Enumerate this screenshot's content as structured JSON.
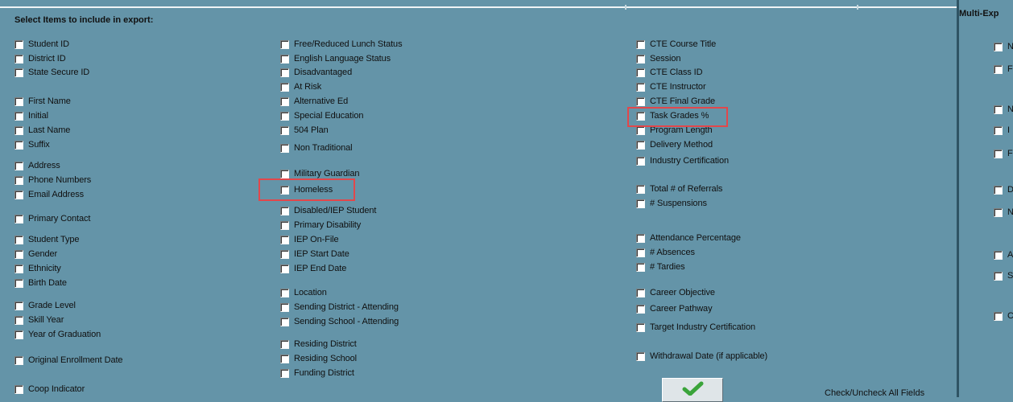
{
  "header": {
    "title": "Select Items to include in export:",
    "right_title": "Multi-Exp"
  },
  "columns": [
    {
      "items": [
        {
          "label": "Student ID",
          "checked": false
        },
        {
          "label": "District ID",
          "checked": false
        },
        {
          "label": "State Secure ID",
          "checked": false
        },
        {
          "label": "First Name",
          "checked": false
        },
        {
          "label": "Initial",
          "checked": false
        },
        {
          "label": "Last Name",
          "checked": false
        },
        {
          "label": "Suffix",
          "checked": false
        },
        {
          "label": "Address",
          "checked": false
        },
        {
          "label": "Phone Numbers",
          "checked": false
        },
        {
          "label": "Email Address",
          "checked": false
        },
        {
          "label": "Primary Contact",
          "checked": false
        },
        {
          "label": "Student Type",
          "checked": false
        },
        {
          "label": "Gender",
          "checked": false
        },
        {
          "label": "Ethnicity",
          "checked": false
        },
        {
          "label": "Birth Date",
          "checked": false
        },
        {
          "label": "Grade Level",
          "checked": false
        },
        {
          "label": "Skill Year",
          "checked": false
        },
        {
          "label": "Year of Graduation",
          "checked": false
        },
        {
          "label": "Original Enrollment Date",
          "checked": false
        },
        {
          "label": "Coop Indicator",
          "checked": false
        }
      ]
    },
    {
      "items": [
        {
          "label": "Free/Reduced Lunch Status",
          "checked": false
        },
        {
          "label": "English Language Status",
          "checked": false
        },
        {
          "label": "Disadvantaged",
          "checked": false
        },
        {
          "label": "At Risk",
          "checked": false
        },
        {
          "label": "Alternative Ed",
          "checked": false
        },
        {
          "label": "Special Education",
          "checked": false
        },
        {
          "label": "504 Plan",
          "checked": false
        },
        {
          "label": "Non Traditional",
          "checked": false
        },
        {
          "label": "Military Guardian",
          "checked": false
        },
        {
          "label": "Homeless",
          "checked": false,
          "highlighted": true
        },
        {
          "label": "Disabled/IEP Student",
          "checked": false
        },
        {
          "label": "Primary Disability",
          "checked": false
        },
        {
          "label": "IEP On-File",
          "checked": false
        },
        {
          "label": "IEP Start Date",
          "checked": false
        },
        {
          "label": "IEP End Date",
          "checked": false
        },
        {
          "label": "Location",
          "checked": false
        },
        {
          "label": "Sending District - Attending",
          "checked": false
        },
        {
          "label": "Sending School - Attending",
          "checked": false
        },
        {
          "label": "Residing District",
          "checked": false
        },
        {
          "label": "Residing School",
          "checked": false
        },
        {
          "label": "Funding District",
          "checked": false
        }
      ]
    },
    {
      "items": [
        {
          "label": "CTE Course Title",
          "checked": false
        },
        {
          "label": "Session",
          "checked": false
        },
        {
          "label": "CTE Class ID",
          "checked": false
        },
        {
          "label": "CTE Instructor",
          "checked": false
        },
        {
          "label": "CTE Final Grade",
          "checked": false
        },
        {
          "label": "Task Grades %",
          "checked": false,
          "highlighted": true
        },
        {
          "label": "Program Length",
          "checked": false
        },
        {
          "label": "Delivery Method",
          "checked": false
        },
        {
          "label": "Industry Certification",
          "checked": false
        },
        {
          "label": "Total # of Referrals",
          "checked": false
        },
        {
          "label": "# Suspensions",
          "checked": false
        },
        {
          "label": "Attendance Percentage",
          "checked": false
        },
        {
          "label": "# Absences",
          "checked": false
        },
        {
          "label": "# Tardies",
          "checked": false
        },
        {
          "label": "Career Objective",
          "checked": false
        },
        {
          "label": "Career Pathway",
          "checked": false
        },
        {
          "label": "Target Industry Certification",
          "checked": false
        },
        {
          "label": "Withdrawal Date (if applicable)",
          "checked": false
        }
      ]
    }
  ],
  "right_column": {
    "items": [
      {
        "label": "N",
        "checked": false
      },
      {
        "label": "F",
        "checked": false
      },
      {
        "label": "N",
        "checked": false
      },
      {
        "label": "I",
        "checked": false
      },
      {
        "label": "F",
        "checked": false
      },
      {
        "label": "D",
        "checked": false
      },
      {
        "label": "N",
        "checked": false
      },
      {
        "label": "A",
        "checked": false
      },
      {
        "label": "S",
        "checked": false
      },
      {
        "label": "C",
        "checked": false
      }
    ]
  },
  "footer": {
    "check_all_label": "Check/Uncheck All Fields",
    "check_all_icon": "checkmark-icon",
    "check_color": "#3aa43a"
  },
  "colors": {
    "background": "#6494a8",
    "highlight": "#e2474b"
  }
}
